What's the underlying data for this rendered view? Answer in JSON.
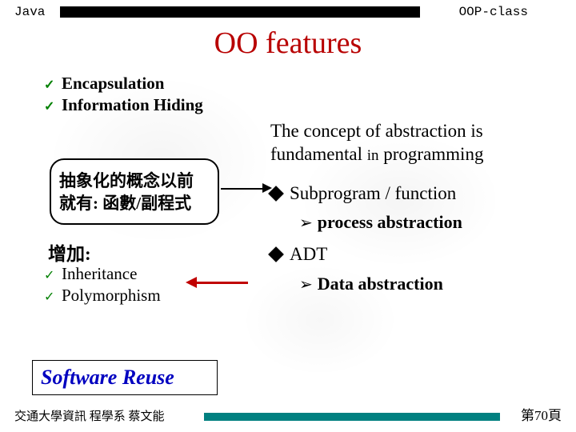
{
  "header": {
    "left": "Java",
    "right": "OOP-class"
  },
  "title": "OO features",
  "checklist1": {
    "item1": "Encapsulation",
    "item2": "Information Hiding"
  },
  "callout": {
    "line1": "抽象化的概念以前",
    "line2": "就有: 函數/副程式"
  },
  "increase_label": "增加:",
  "checklist2": {
    "item1": "Inheritance",
    "item2": "Polymorphism"
  },
  "right": {
    "intro_a": "The concept of abstraction is fundamental ",
    "intro_b": "in",
    "intro_c": " programming",
    "sub1": "Subprogram / function",
    "sub1_arrow": "process abstraction",
    "sub2": "ADT",
    "sub2_arrow": "Data abstraction"
  },
  "software_reuse": "Software Reuse",
  "footer": {
    "left": "交通大學資訊 程學系 蔡文能",
    "right": "第70頁"
  }
}
